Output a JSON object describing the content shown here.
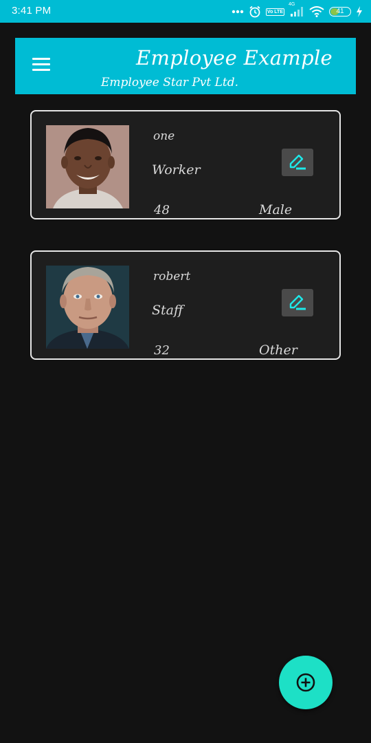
{
  "status_bar": {
    "time": "3:41 PM",
    "volte_label": "Vo LTE",
    "network_label": "4G",
    "battery_level": "41",
    "icons": [
      "more-dots-icon",
      "alarm-icon",
      "volte-icon",
      "signal-icon",
      "wifi-icon",
      "battery-icon",
      "charging-icon"
    ]
  },
  "app_bar": {
    "title": "Employee Example",
    "subtitle": "Employee Star Pvt Ltd.",
    "menu_icon": "hamburger-menu-icon",
    "color": "#00bcd4"
  },
  "employees": [
    {
      "name": "one",
      "role": "Worker",
      "age": "48",
      "gender": "Male",
      "edit_icon": "edit-pen-icon"
    },
    {
      "name": "robert",
      "role": "Staff",
      "age": "32",
      "gender": "Other",
      "edit_icon": "edit-pen-icon"
    }
  ],
  "fab": {
    "icon": "add-circle-icon",
    "color": "#1de0c6"
  },
  "colors": {
    "background": "#121212",
    "card_background": "#1e1e1e",
    "card_border": "#e6e6e6",
    "edit_icon": "#1de9e9"
  }
}
